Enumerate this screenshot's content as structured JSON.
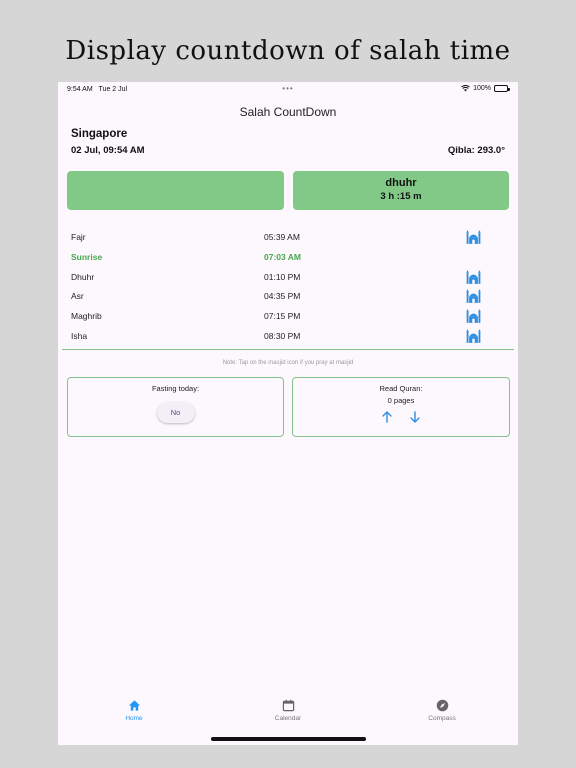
{
  "headline": "Display countdown of salah time",
  "status_bar": {
    "time": "9:54 AM",
    "date": "Tue 2 Jul",
    "dots": "•••",
    "battery": "100%"
  },
  "app_title": "Salah CountDown",
  "location": "Singapore",
  "datetime": "02 Jul, 09:54 AM",
  "qibla": "Qibla: 293.0°",
  "next_prayer": {
    "name": "dhuhr",
    "remaining": "3 h :15 m"
  },
  "prayers": [
    {
      "name": "Fajr",
      "time": "05:39 AM",
      "mosque_icon": true,
      "current": false
    },
    {
      "name": "Sunrise",
      "time": "07:03 AM",
      "mosque_icon": false,
      "current": true
    },
    {
      "name": "Dhuhr",
      "time": "01:10 PM",
      "mosque_icon": true,
      "current": false
    },
    {
      "name": "Asr",
      "time": "04:35 PM",
      "mosque_icon": true,
      "current": false
    },
    {
      "name": "Maghrib",
      "time": "07:15 PM",
      "mosque_icon": true,
      "current": false
    },
    {
      "name": "Isha",
      "time": "08:30 PM",
      "mosque_icon": true,
      "current": false
    }
  ],
  "note": "Note: Tap on the masjid icon if you pray at masjid",
  "fasting": {
    "label": "Fasting today:",
    "value": "No"
  },
  "quran": {
    "label": "Read Quran:",
    "pages": "0 pages"
  },
  "nav": [
    {
      "label": "Home",
      "icon": "home-icon",
      "active": true
    },
    {
      "label": "Calendar",
      "icon": "calendar-icon",
      "active": false
    },
    {
      "label": "Compass",
      "icon": "compass-icon",
      "active": false
    }
  ],
  "colors": {
    "accent_green": "#82c987",
    "current_prayer": "#46a84d",
    "mosque_blue": "#2f8fe0",
    "nav_active": "#2196f3"
  }
}
